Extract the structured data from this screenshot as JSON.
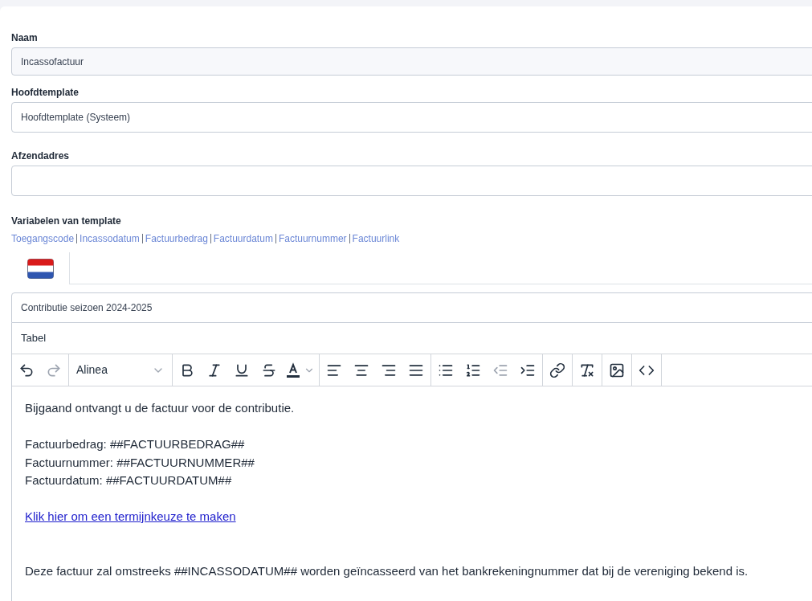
{
  "fields": [
    {
      "label": "Naam",
      "value": "Incassofactuur",
      "readonly": true
    },
    {
      "label": "Hoofdtemplate",
      "value": "Hoofdtemplate (Systeem)",
      "readonly": false
    },
    {
      "label": "Afzendadres",
      "readonly": false
    }
  ],
  "variables": {
    "label": "Variabelen van template",
    "items": [
      "Toegangscode",
      "Incassodatum",
      "Factuurbedrag",
      "Factuurdatum",
      "Factuurnummer",
      "Factuurlink"
    ]
  },
  "language_tabs": [
    {
      "kind": "nl",
      "selected": true
    }
  ],
  "subject": {
    "value": "Contributie seizoen 2024-2025"
  },
  "menubar": {
    "label": "Tabel"
  },
  "toolbar": [
    [
      {
        "kind": "undo",
        "disabled": false
      },
      {
        "kind": "redo",
        "disabled": true
      }
    ],
    [
      {
        "kind": "select",
        "label": "Alinea",
        "disabled": false
      }
    ],
    [
      {
        "kind": "bold",
        "disabled": false
      },
      {
        "kind": "italic",
        "disabled": false
      },
      {
        "kind": "underline",
        "disabled": false
      },
      {
        "kind": "strike",
        "disabled": false
      },
      {
        "kind": "textcolor",
        "disabled": false
      }
    ],
    [
      {
        "kind": "alignleft",
        "disabled": false
      },
      {
        "kind": "aligncenter",
        "disabled": false
      },
      {
        "kind": "alignright",
        "disabled": false
      },
      {
        "kind": "justify",
        "disabled": false
      }
    ],
    [
      {
        "kind": "bullets",
        "disabled": false
      },
      {
        "kind": "numbers",
        "disabled": false
      },
      {
        "kind": "outdent",
        "disabled": true
      },
      {
        "kind": "indent",
        "disabled": false
      }
    ],
    [
      {
        "kind": "link",
        "disabled": false
      }
    ],
    [
      {
        "kind": "clearformat",
        "disabled": false
      }
    ],
    [
      {
        "kind": "image",
        "disabled": false
      }
    ],
    [
      {
        "kind": "code",
        "disabled": false
      }
    ]
  ],
  "body": [
    {
      "kind": "text",
      "text": "Bijgaand ontvangt u de factuur voor de contributie."
    },
    {
      "kind": "blank"
    },
    {
      "kind": "text",
      "text": "Factuurbedrag: ##FACTUURBEDRAG##"
    },
    {
      "kind": "text",
      "text": "Factuurnummer: ##FACTUURNUMMER##"
    },
    {
      "kind": "text",
      "text": "Factuurdatum: ##FACTUURDATUM##"
    },
    {
      "kind": "blank"
    },
    {
      "kind": "link",
      "text": "Klik hier om een termijnkeuze te maken"
    },
    {
      "kind": "blank"
    },
    {
      "kind": "blank"
    },
    {
      "kind": "text",
      "text": "Deze factuur zal omstreeks ##INCASSODATUM## worden geïncasseerd van het bankrekeningnummer dat bij de vereniging bekend is."
    }
  ]
}
